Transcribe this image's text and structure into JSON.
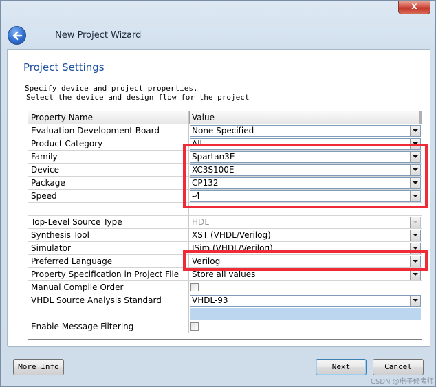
{
  "window": {
    "title": "New Project Wizard",
    "close_glyph": "x"
  },
  "page": {
    "title": "Project Settings",
    "description_line1": "Specify device and project properties.",
    "description_line2": "Select the device and design flow for the project"
  },
  "table": {
    "header_name": "Property Name",
    "header_value": "Value",
    "rows": [
      {
        "name": "Evaluation Development Board",
        "value": "None Specified",
        "type": "combo"
      },
      {
        "name": "Product Category",
        "value": "All",
        "type": "combo"
      },
      {
        "name": "Family",
        "value": "Spartan3E",
        "type": "combo"
      },
      {
        "name": "Device",
        "value": "XC3S100E",
        "type": "combo"
      },
      {
        "name": "Package",
        "value": "CP132",
        "type": "combo"
      },
      {
        "name": "Speed",
        "value": "-4",
        "type": "combo"
      },
      {
        "name": "",
        "value": "",
        "type": "blank"
      },
      {
        "name": "Top-Level Source Type",
        "value": "HDL",
        "type": "combo-disabled"
      },
      {
        "name": "Synthesis Tool",
        "value": "XST (VHDL/Verilog)",
        "type": "combo"
      },
      {
        "name": "Simulator",
        "value": "ISim (VHDL/Verilog)",
        "type": "combo"
      },
      {
        "name": "Preferred Language",
        "value": "Verilog",
        "type": "combo"
      },
      {
        "name": "Property Specification in Project File",
        "value": "Store all values",
        "type": "combo"
      },
      {
        "name": "Manual Compile Order",
        "value": "",
        "type": "checkbox"
      },
      {
        "name": "VHDL Source Analysis Standard",
        "value": "VHDL-93",
        "type": "combo"
      },
      {
        "name": "",
        "value": "",
        "type": "blue"
      },
      {
        "name": "Enable Message Filtering",
        "value": "",
        "type": "checkbox"
      }
    ]
  },
  "buttons": {
    "more_info": "More Info",
    "next": "Next",
    "cancel": "Cancel"
  },
  "watermark": "CSDN @电子修考师",
  "colors": {
    "title_blue": "#1c4fa0",
    "highlight_red": "#ee2b36"
  }
}
